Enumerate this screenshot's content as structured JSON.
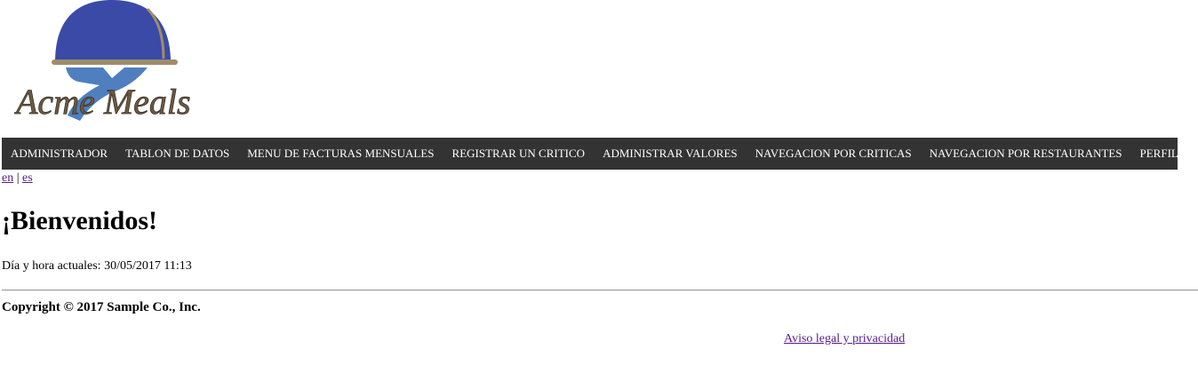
{
  "logo": {
    "text": "Acme Meals",
    "colors": {
      "dome": "#3a4aa6",
      "tray": "#a08c6c",
      "hand": "#4f7fbf",
      "text": "#6b5a44"
    }
  },
  "navbar": {
    "background": "#333333",
    "items": [
      {
        "label": "ADMINISTRADOR"
      },
      {
        "label": "TABLON DE DATOS"
      },
      {
        "label": "MENU DE FACTURAS MENSUALES"
      },
      {
        "label": "REGISTRAR UN CRITICO"
      },
      {
        "label": "ADMINISTRAR VALORES"
      },
      {
        "label": "NAVEGACION POR CRITICAS"
      },
      {
        "label": "NAVEGACION POR RESTAURANTES"
      },
      {
        "label": "PERFIL (ADMIN)"
      }
    ]
  },
  "language": {
    "en": "en",
    "separator": "|",
    "es": "es"
  },
  "main": {
    "welcome": "¡Bienvenidos!",
    "datetime": "Día y hora actuales: 30/05/2017 11:13"
  },
  "footer": {
    "copyright": "Copyright © 2017 Sample Co., Inc.",
    "legal_link": "Aviso legal y privacidad"
  }
}
